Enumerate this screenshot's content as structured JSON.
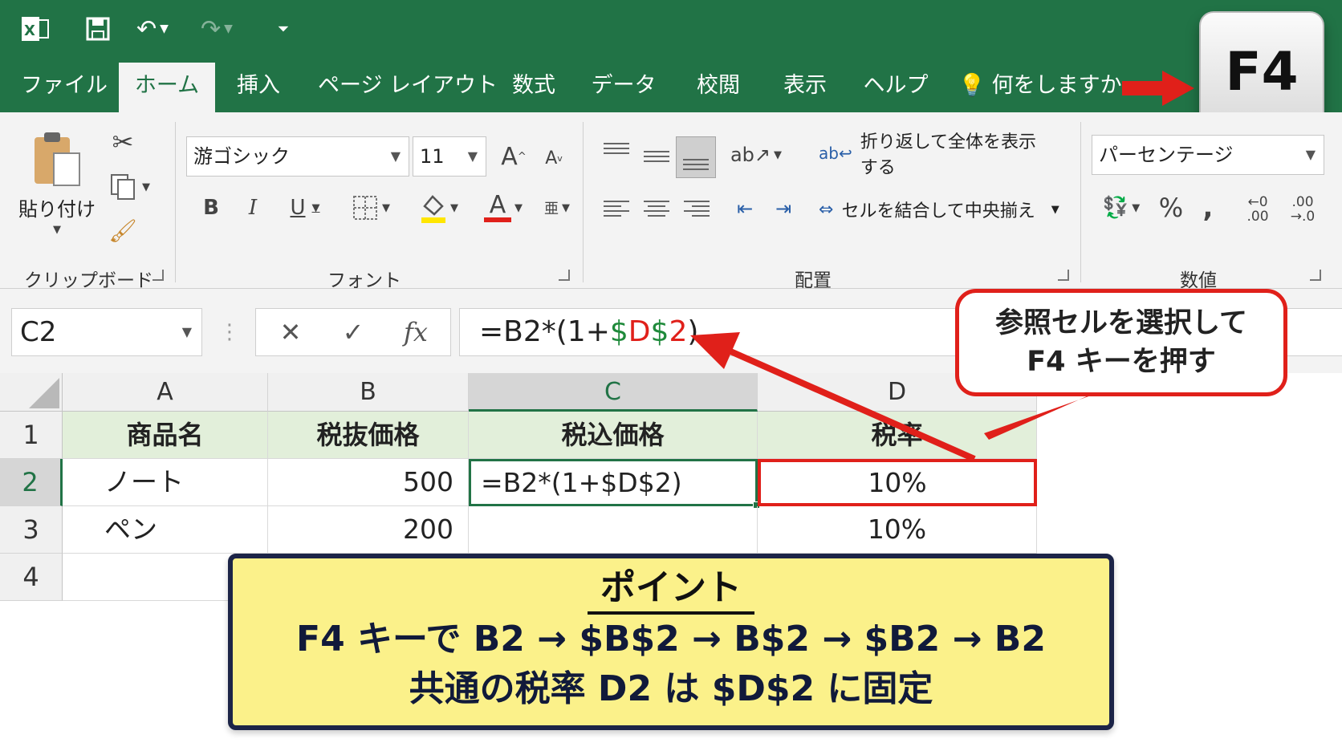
{
  "ribbon_tabs": [
    "ファイル",
    "ホーム",
    "挿入",
    "ページ レイアウト",
    "数式",
    "データ",
    "校閲",
    "表示",
    "ヘルプ"
  ],
  "active_tab": "ホーム",
  "tell_me": "何をしますか",
  "key_label": "F4",
  "clipboard": {
    "paste_label": "貼り付け",
    "group_label": "クリップボード"
  },
  "font": {
    "name": "游ゴシック",
    "size": "11",
    "group_label": "フォント",
    "bold": "B",
    "italic": "I",
    "underline": "U",
    "font_color": "A",
    "grow": "A",
    "shrink": "A"
  },
  "alignment": {
    "wrap_text": "折り返して全体を表示する",
    "merge_center": "セルを結合して中央揃え",
    "group_label": "配置"
  },
  "number": {
    "format": "パーセンテージ",
    "percent": "%",
    "comma": ",",
    "inc_decimal": "←0 .00",
    "dec_decimal": ".00 →.0",
    "group_label": "数値"
  },
  "formula_bar": {
    "name_box": "C2",
    "fx": "fx",
    "formula_parts": [
      {
        "text": "=B2*(1+",
        "color": "#222222"
      },
      {
        "text": "$",
        "color": "#1f8a3b"
      },
      {
        "text": "D",
        "color": "#e0201a"
      },
      {
        "text": "$",
        "color": "#1f8a3b"
      },
      {
        "text": "2",
        "color": "#e0201a"
      },
      {
        "text": ")",
        "color": "#222222"
      }
    ]
  },
  "sheet": {
    "columns": [
      "A",
      "B",
      "C",
      "D"
    ],
    "rows": [
      "1",
      "2",
      "3",
      "4"
    ],
    "cells": [
      [
        "商品名",
        "税抜価格",
        "税込価格",
        "税率"
      ],
      [
        "ノート",
        "500",
        "=B2*(1+$D$2)",
        "10%"
      ],
      [
        "ペン",
        "200",
        "",
        "10%"
      ],
      [
        "",
        "",
        "",
        ""
      ]
    ]
  },
  "callout": {
    "line1": "参照セルを選択して",
    "line2": "F4 キーを押す"
  },
  "point": {
    "title": "ポイント",
    "line1": "F4 キーで B2 → $B$2 → B$2 →  $B2 → B2",
    "line2": "共通の税率 D2 は $D$2 に固定"
  },
  "colors": {
    "excel_green": "#217346",
    "accent_red": "#e0201a",
    "point_bg": "#fbf18a",
    "header_fill": "#e2efda"
  }
}
